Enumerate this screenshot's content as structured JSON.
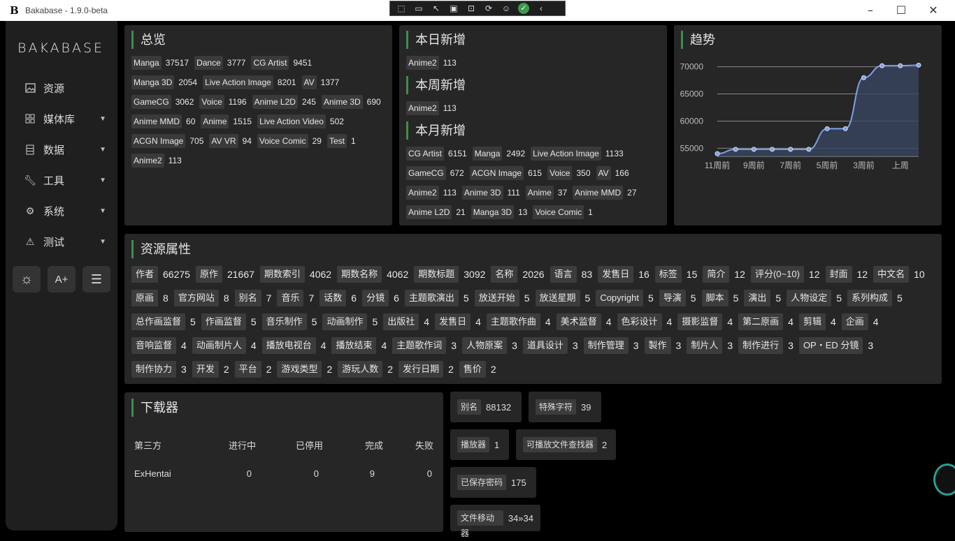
{
  "window": {
    "title": "Bakabase - 1.9.0-beta",
    "logo": "B"
  },
  "sidebar": {
    "brand": "BAKABASE",
    "items": [
      {
        "label": "资源",
        "icon": "image-icon"
      },
      {
        "label": "媒体库",
        "icon": "grid-icon"
      },
      {
        "label": "数据",
        "icon": "data-icon"
      },
      {
        "label": "工具",
        "icon": "wrench-icon"
      },
      {
        "label": "系统",
        "icon": "gear-icon"
      },
      {
        "label": "测试",
        "icon": "warning-icon"
      }
    ]
  },
  "overview": {
    "title": "总览",
    "tags": [
      {
        "label": "Manga",
        "value": "37517"
      },
      {
        "label": "Dance",
        "value": "3777"
      },
      {
        "label": "CG Artist",
        "value": "9451"
      },
      {
        "label": "Manga 3D",
        "value": "2054"
      },
      {
        "label": "Live Action Image",
        "value": "8201"
      },
      {
        "label": "AV",
        "value": "1377"
      },
      {
        "label": "GameCG",
        "value": "3062"
      },
      {
        "label": "Voice",
        "value": "1196"
      },
      {
        "label": "Anime L2D",
        "value": "245"
      },
      {
        "label": "Anime 3D",
        "value": "690"
      },
      {
        "label": "Anime MMD",
        "value": "60"
      },
      {
        "label": "Anime",
        "value": "1515"
      },
      {
        "label": "Live Action Video",
        "value": "502"
      },
      {
        "label": "ACGN Image",
        "value": "705"
      },
      {
        "label": "AV VR",
        "value": "94"
      },
      {
        "label": "Voice Comic",
        "value": "29"
      },
      {
        "label": "Test",
        "value": "1"
      },
      {
        "label": "Anime2",
        "value": "113"
      }
    ]
  },
  "new": {
    "day_title": "本日新增",
    "day": [
      {
        "label": "Anime2",
        "value": "113"
      }
    ],
    "week_title": "本周新增",
    "week": [
      {
        "label": "Anime2",
        "value": "113"
      }
    ],
    "month_title": "本月新增",
    "month": [
      {
        "label": "CG Artist",
        "value": "6151"
      },
      {
        "label": "Manga",
        "value": "2492"
      },
      {
        "label": "Live Action Image",
        "value": "1133"
      },
      {
        "label": "GameCG",
        "value": "672"
      },
      {
        "label": "ACGN Image",
        "value": "615"
      },
      {
        "label": "Voice",
        "value": "350"
      },
      {
        "label": "AV",
        "value": "166"
      },
      {
        "label": "Anime2",
        "value": "113"
      },
      {
        "label": "Anime 3D",
        "value": "111"
      },
      {
        "label": "Anime",
        "value": "37"
      },
      {
        "label": "Anime MMD",
        "value": "27"
      },
      {
        "label": "Anime L2D",
        "value": "21"
      },
      {
        "label": "Manga 3D",
        "value": "13"
      },
      {
        "label": "Voice Comic",
        "value": "1"
      }
    ]
  },
  "trend": {
    "title": "趋势"
  },
  "chart_data": {
    "type": "line",
    "x": [
      "11周前",
      "10周前",
      "9周前",
      "8周前",
      "7周前",
      "6周前",
      "5周前",
      "4周前",
      "3周前",
      "2周前",
      "上周",
      "本周"
    ],
    "x_tick_labels": [
      "11周前",
      "9周前",
      "7周前",
      "5周前",
      "3周前",
      "上周"
    ],
    "series": [
      {
        "values": [
          54000,
          54800,
          54800,
          54800,
          54800,
          54800,
          58600,
          58600,
          68000,
          70200,
          70200,
          70300
        ]
      }
    ],
    "yticks": [
      55000,
      60000,
      65000,
      70000
    ],
    "ylim": [
      53500,
      71500
    ],
    "color": "#7ea0e6",
    "grid": true
  },
  "attributes": {
    "title": "资源属性",
    "tags": [
      {
        "label": "作者",
        "value": "66275"
      },
      {
        "label": "原作",
        "value": "21667"
      },
      {
        "label": "期数索引",
        "value": "4062"
      },
      {
        "label": "期数名称",
        "value": "4062"
      },
      {
        "label": "期数标题",
        "value": "3092"
      },
      {
        "label": "名称",
        "value": "2026"
      },
      {
        "label": "语言",
        "value": "83"
      },
      {
        "label": "发售日",
        "value": "16"
      },
      {
        "label": "标签",
        "value": "15"
      },
      {
        "label": "简介",
        "value": "12"
      },
      {
        "label": "评分(0~10)",
        "value": "12"
      },
      {
        "label": "封面",
        "value": "12"
      },
      {
        "label": "中文名",
        "value": "10"
      },
      {
        "label": "原画",
        "value": "8"
      },
      {
        "label": "官方网站",
        "value": "8"
      },
      {
        "label": "别名",
        "value": "7"
      },
      {
        "label": "音乐",
        "value": "7"
      },
      {
        "label": "话数",
        "value": "6"
      },
      {
        "label": "分镜",
        "value": "6"
      },
      {
        "label": "主题歌演出",
        "value": "5"
      },
      {
        "label": "放送开始",
        "value": "5"
      },
      {
        "label": "放送星期",
        "value": "5"
      },
      {
        "label": "Copyright",
        "value": "5"
      },
      {
        "label": "导演",
        "value": "5"
      },
      {
        "label": "脚本",
        "value": "5"
      },
      {
        "label": "演出",
        "value": "5"
      },
      {
        "label": "人物设定",
        "value": "5"
      },
      {
        "label": "系列构成",
        "value": "5"
      },
      {
        "label": "总作画监督",
        "value": "5"
      },
      {
        "label": "作画监督",
        "value": "5"
      },
      {
        "label": "音乐制作",
        "value": "5"
      },
      {
        "label": "动画制作",
        "value": "5"
      },
      {
        "label": "出版社",
        "value": "4"
      },
      {
        "label": "发售日",
        "value": "4"
      },
      {
        "label": "主题歌作曲",
        "value": "4"
      },
      {
        "label": "美术监督",
        "value": "4"
      },
      {
        "label": "色彩设计",
        "value": "4"
      },
      {
        "label": "摄影监督",
        "value": "4"
      },
      {
        "label": "第二原画",
        "value": "4"
      },
      {
        "label": "剪辑",
        "value": "4"
      },
      {
        "label": "企画",
        "value": "4"
      },
      {
        "label": "音响监督",
        "value": "4"
      },
      {
        "label": "动画制片人",
        "value": "4"
      },
      {
        "label": "播放电视台",
        "value": "4"
      },
      {
        "label": "播放结束",
        "value": "4"
      },
      {
        "label": "主题歌作词",
        "value": "3"
      },
      {
        "label": "人物原案",
        "value": "3"
      },
      {
        "label": "道具设计",
        "value": "3"
      },
      {
        "label": "制作管理",
        "value": "3"
      },
      {
        "label": "製作",
        "value": "3"
      },
      {
        "label": "制片人",
        "value": "3"
      },
      {
        "label": "制作进行",
        "value": "3"
      },
      {
        "label": "OP・ED 分镜",
        "value": "3"
      },
      {
        "label": "制作协力",
        "value": "3"
      },
      {
        "label": "开发",
        "value": "2"
      },
      {
        "label": "平台",
        "value": "2"
      },
      {
        "label": "游戏类型",
        "value": "2"
      },
      {
        "label": "游玩人数",
        "value": "2"
      },
      {
        "label": "发行日期",
        "value": "2"
      },
      {
        "label": "售价",
        "value": "2"
      }
    ]
  },
  "downloader": {
    "title": "下载器",
    "headers": [
      "第三方",
      "进行中",
      "已停用",
      "完成",
      "失败"
    ],
    "rows": [
      [
        "ExHentai",
        "0",
        "0",
        "9",
        "0"
      ]
    ]
  },
  "counters": {
    "alias": {
      "label": "别名",
      "value": "88132"
    },
    "special": {
      "label": "特殊字符",
      "value": "39"
    },
    "player": {
      "label": "播放器",
      "value": "1"
    },
    "finder": {
      "label": "可播放文件查找器",
      "value": "2"
    },
    "passwords": {
      "label": "已保存密码",
      "value": "175"
    },
    "mover": {
      "label": "文件移动器",
      "value": "34»34"
    }
  }
}
